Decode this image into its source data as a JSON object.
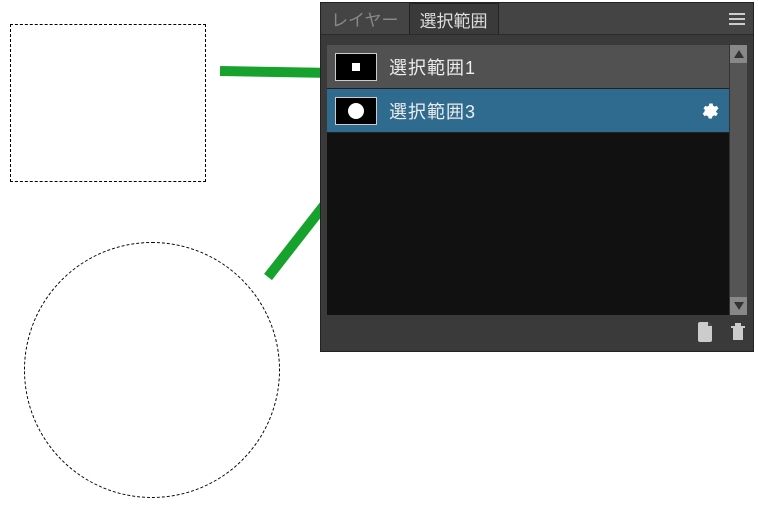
{
  "tabs": {
    "inactive_label": "レイヤー",
    "active_label": "選択範囲"
  },
  "selections": [
    {
      "label": "選択範囲1",
      "shape": "square",
      "selected": false
    },
    {
      "label": "選択範囲3",
      "shape": "circle",
      "selected": true
    }
  ],
  "icons": {
    "menu": "menu-icon",
    "gear": "gear-icon",
    "new": "new-selection-icon",
    "trash": "trash-icon",
    "up": "scroll-up-icon",
    "down": "scroll-down-icon"
  }
}
